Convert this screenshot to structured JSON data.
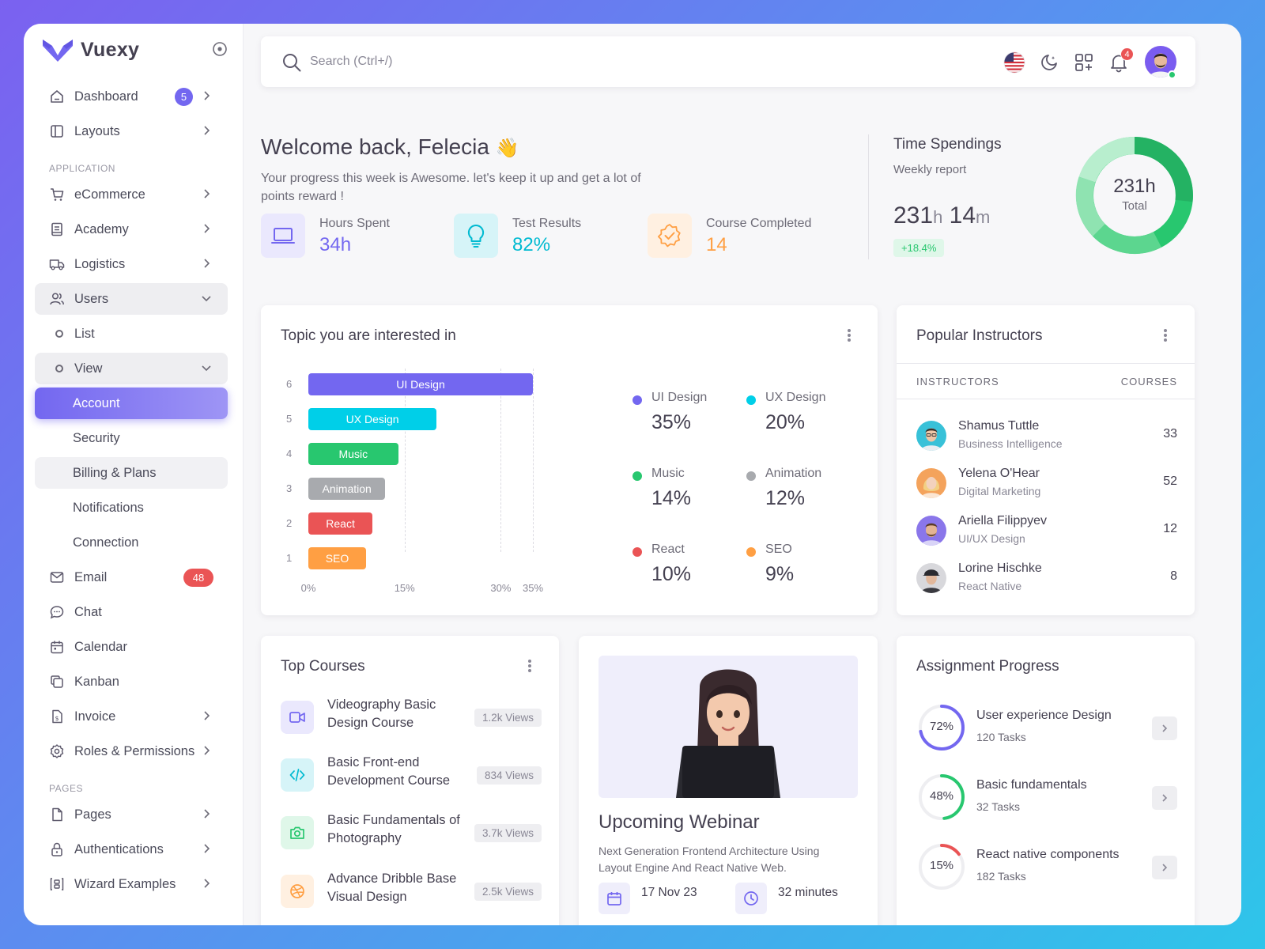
{
  "app": {
    "name": "Vuexy"
  },
  "sidebar": {
    "dashboard": {
      "label": "Dashboard",
      "badge": "5"
    },
    "layouts": {
      "label": "Layouts"
    },
    "header_application": "APPLICATION",
    "ecommerce": {
      "label": "eCommerce"
    },
    "academy": {
      "label": "Academy"
    },
    "logistics": {
      "label": "Logistics"
    },
    "users": {
      "label": "Users"
    },
    "users_list": {
      "label": "List"
    },
    "users_view": {
      "label": "View"
    },
    "view_items": [
      "Account",
      "Security",
      "Billing & Plans",
      "Notifications",
      "Connection"
    ],
    "email": {
      "label": "Email",
      "badge": "48"
    },
    "chat": {
      "label": "Chat"
    },
    "calendar": {
      "label": "Calendar"
    },
    "kanban": {
      "label": "Kanban"
    },
    "invoice": {
      "label": "Invoice"
    },
    "roles": {
      "label": "Roles & Permissions"
    },
    "header_pages": "PAGES",
    "pages": {
      "label": "Pages"
    },
    "auth": {
      "label": "Authentications"
    },
    "wizard": {
      "label": "Wizard Examples"
    }
  },
  "topbar": {
    "search_placeholder": "Search (Ctrl+/)",
    "notifications_count": "4"
  },
  "welcome": {
    "title": "Welcome back, Felecia",
    "wave": "👋",
    "subtitle": "Your progress this week is Awesome. let's keep it up and get a lot of points reward !",
    "stats": [
      {
        "label": "Hours Spent",
        "value": "34h",
        "color": "#7367f0"
      },
      {
        "label": "Test Results",
        "value": "82%",
        "color": "#00bad1"
      },
      {
        "label": "Course Completed",
        "value": "14",
        "color": "#ff9f43"
      }
    ]
  },
  "time_spendings": {
    "title": "Time Spendings",
    "subtitle": "Weekly report",
    "hours": "231",
    "hours_unit": "h",
    "minutes": "14",
    "minutes_unit": "m",
    "change": "+18.4%",
    "donut_value": "231h",
    "donut_label": "Total"
  },
  "topics": {
    "title": "Topic you are interested in",
    "legend": [
      {
        "label": "UI Design",
        "value": "35%",
        "color": "#7367f0"
      },
      {
        "label": "UX Design",
        "value": "20%",
        "color": "#00cfe8"
      },
      {
        "label": "Music",
        "value": "14%",
        "color": "#28c76f"
      },
      {
        "label": "Animation",
        "value": "12%",
        "color": "#a8aaae"
      },
      {
        "label": "React",
        "value": "10%",
        "color": "#ea5455"
      },
      {
        "label": "SEO",
        "value": "9%",
        "color": "#ff9f43"
      }
    ]
  },
  "chart_data": {
    "type": "bar",
    "orientation": "horizontal",
    "categories": [
      "UI Design",
      "UX Design",
      "Music",
      "Animation",
      "React",
      "SEO"
    ],
    "y_tick_labels": [
      "6",
      "5",
      "4",
      "3",
      "2",
      "1"
    ],
    "values": [
      35,
      20,
      14,
      12,
      10,
      9
    ],
    "colors": [
      "#7367f0",
      "#00cfe8",
      "#28c76f",
      "#a8aaae",
      "#ea5455",
      "#ff9f43"
    ],
    "x_ticks": [
      "0%",
      "15%",
      "30%",
      "35%"
    ],
    "xlim": [
      0,
      35
    ],
    "grid": true
  },
  "instructors": {
    "title": "Popular Instructors",
    "col_instructors": "INSTRUCTORS",
    "col_courses": "COURSES",
    "rows": [
      {
        "name": "Shamus Tuttle",
        "role": "Business Intelligence",
        "courses": "33"
      },
      {
        "name": "Yelena O'Hear",
        "role": "Digital Marketing",
        "courses": "52"
      },
      {
        "name": "Ariella Filippyev",
        "role": "UI/UX Design",
        "courses": "12"
      },
      {
        "name": "Lorine Hischke",
        "role": "React Native",
        "courses": "8"
      }
    ]
  },
  "top_courses": {
    "title": "Top Courses",
    "rows": [
      {
        "name": "Videography Basic Design Course",
        "views": "1.2k Views",
        "icon": "video-icon",
        "color": "#7367f0"
      },
      {
        "name": "Basic Front-end Development Course",
        "views": "834 Views",
        "icon": "code-icon",
        "color": "#00bad1"
      },
      {
        "name": "Basic Fundamentals of Photography",
        "views": "3.7k Views",
        "icon": "camera-icon",
        "color": "#28c76f"
      },
      {
        "name": "Advance Dribble Base Visual Design",
        "views": "2.5k Views",
        "icon": "dribbble-icon",
        "color": "#ff9f43"
      }
    ]
  },
  "webinar": {
    "title": "Upcoming Webinar",
    "description": "Next Generation Frontend Architecture Using Layout Engine And React Native Web.",
    "date": "17 Nov 23",
    "duration": "32 minutes"
  },
  "assignments": {
    "title": "Assignment Progress",
    "rows": [
      {
        "name": "User experience Design",
        "tasks": "120 Tasks",
        "percent": "72%",
        "progress": 0.72,
        "color": "#7367f0"
      },
      {
        "name": "Basic fundamentals",
        "tasks": "32 Tasks",
        "percent": "48%",
        "progress": 0.48,
        "color": "#28c76f"
      },
      {
        "name": "React native components",
        "tasks": "182 Tasks",
        "percent": "15%",
        "progress": 0.15,
        "color": "#ea5455"
      }
    ]
  }
}
